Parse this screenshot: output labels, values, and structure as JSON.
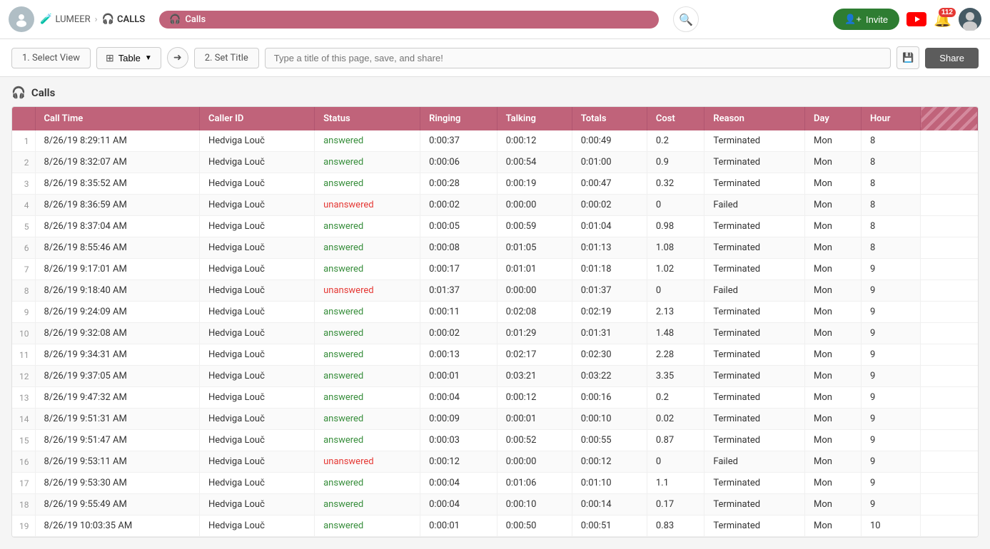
{
  "navbar": {
    "avatar_label": "avatar",
    "breadcrumb": [
      {
        "id": "lumeer",
        "icon": "🧪",
        "label": "LUMEER"
      },
      {
        "id": "calls",
        "icon": "🎧",
        "label": "CALLS"
      }
    ],
    "search_placeholder": "Calls",
    "invite_label": "Invite",
    "notif_count": "112",
    "calls_tab": "Calls"
  },
  "toolbar": {
    "step1_label": "1. Select View",
    "table_label": "Table",
    "step2_label": "2. Set Title",
    "title_placeholder": "Type a title of this page, save, and share!",
    "share_label": "Share"
  },
  "section": {
    "icon": "🎧",
    "title": "Calls"
  },
  "table": {
    "columns": [
      {
        "id": "call_time",
        "label": "Call Time"
      },
      {
        "id": "caller_id",
        "label": "Caller ID"
      },
      {
        "id": "status",
        "label": "Status"
      },
      {
        "id": "ringing",
        "label": "Ringing"
      },
      {
        "id": "talking",
        "label": "Talking"
      },
      {
        "id": "totals",
        "label": "Totals"
      },
      {
        "id": "cost",
        "label": "Cost"
      },
      {
        "id": "reason",
        "label": "Reason"
      },
      {
        "id": "day",
        "label": "Day"
      },
      {
        "id": "hour",
        "label": "Hour"
      },
      {
        "id": "extra",
        "label": ""
      }
    ],
    "rows": [
      {
        "num": 1,
        "call_time": "8/26/19 8:29:11 AM",
        "caller_id": "Hedviga Louč",
        "status": "answered",
        "ringing": "0:00:37",
        "talking": "0:00:12",
        "totals": "0:00:49",
        "cost": "0.2",
        "reason": "Terminated",
        "day": "Mon",
        "hour": "8"
      },
      {
        "num": 2,
        "call_time": "8/26/19 8:32:07 AM",
        "caller_id": "Hedviga Louč",
        "status": "answered",
        "ringing": "0:00:06",
        "talking": "0:00:54",
        "totals": "0:01:00",
        "cost": "0.9",
        "reason": "Terminated",
        "day": "Mon",
        "hour": "8"
      },
      {
        "num": 3,
        "call_time": "8/26/19 8:35:52 AM",
        "caller_id": "Hedviga Louč",
        "status": "answered",
        "ringing": "0:00:28",
        "talking": "0:00:19",
        "totals": "0:00:47",
        "cost": "0.32",
        "reason": "Terminated",
        "day": "Mon",
        "hour": "8"
      },
      {
        "num": 4,
        "call_time": "8/26/19 8:36:59 AM",
        "caller_id": "Hedviga Louč",
        "status": "unanswered",
        "ringing": "0:00:02",
        "talking": "0:00:00",
        "totals": "0:00:02",
        "cost": "0",
        "reason": "Failed",
        "day": "Mon",
        "hour": "8"
      },
      {
        "num": 5,
        "call_time": "8/26/19 8:37:04 AM",
        "caller_id": "Hedviga Louč",
        "status": "answered",
        "ringing": "0:00:05",
        "talking": "0:00:59",
        "totals": "0:01:04",
        "cost": "0.98",
        "reason": "Terminated",
        "day": "Mon",
        "hour": "8"
      },
      {
        "num": 6,
        "call_time": "8/26/19 8:55:46 AM",
        "caller_id": "Hedviga Louč",
        "status": "answered",
        "ringing": "0:00:08",
        "talking": "0:01:05",
        "totals": "0:01:13",
        "cost": "1.08",
        "reason": "Terminated",
        "day": "Mon",
        "hour": "8"
      },
      {
        "num": 7,
        "call_time": "8/26/19 9:17:01 AM",
        "caller_id": "Hedviga Louč",
        "status": "answered",
        "ringing": "0:00:17",
        "talking": "0:01:01",
        "totals": "0:01:18",
        "cost": "1.02",
        "reason": "Terminated",
        "day": "Mon",
        "hour": "9"
      },
      {
        "num": 8,
        "call_time": "8/26/19 9:18:40 AM",
        "caller_id": "Hedviga Louč",
        "status": "unanswered",
        "ringing": "0:01:37",
        "talking": "0:00:00",
        "totals": "0:01:37",
        "cost": "0",
        "reason": "Failed",
        "day": "Mon",
        "hour": "9"
      },
      {
        "num": 9,
        "call_time": "8/26/19 9:24:09 AM",
        "caller_id": "Hedviga Louč",
        "status": "answered",
        "ringing": "0:00:11",
        "talking": "0:02:08",
        "totals": "0:02:19",
        "cost": "2.13",
        "reason": "Terminated",
        "day": "Mon",
        "hour": "9"
      },
      {
        "num": 10,
        "call_time": "8/26/19 9:32:08 AM",
        "caller_id": "Hedviga Louč",
        "status": "answered",
        "ringing": "0:00:02",
        "talking": "0:01:29",
        "totals": "0:01:31",
        "cost": "1.48",
        "reason": "Terminated",
        "day": "Mon",
        "hour": "9"
      },
      {
        "num": 11,
        "call_time": "8/26/19 9:34:31 AM",
        "caller_id": "Hedviga Louč",
        "status": "answered",
        "ringing": "0:00:13",
        "talking": "0:02:17",
        "totals": "0:02:30",
        "cost": "2.28",
        "reason": "Terminated",
        "day": "Mon",
        "hour": "9"
      },
      {
        "num": 12,
        "call_time": "8/26/19 9:37:05 AM",
        "caller_id": "Hedviga Louč",
        "status": "answered",
        "ringing": "0:00:01",
        "talking": "0:03:21",
        "totals": "0:03:22",
        "cost": "3.35",
        "reason": "Terminated",
        "day": "Mon",
        "hour": "9"
      },
      {
        "num": 13,
        "call_time": "8/26/19 9:47:32 AM",
        "caller_id": "Hedviga Louč",
        "status": "answered",
        "ringing": "0:00:04",
        "talking": "0:00:12",
        "totals": "0:00:16",
        "cost": "0.2",
        "reason": "Terminated",
        "day": "Mon",
        "hour": "9"
      },
      {
        "num": 14,
        "call_time": "8/26/19 9:51:31 AM",
        "caller_id": "Hedviga Louč",
        "status": "answered",
        "ringing": "0:00:09",
        "talking": "0:00:01",
        "totals": "0:00:10",
        "cost": "0.02",
        "reason": "Terminated",
        "day": "Mon",
        "hour": "9"
      },
      {
        "num": 15,
        "call_time": "8/26/19 9:51:47 AM",
        "caller_id": "Hedviga Louč",
        "status": "answered",
        "ringing": "0:00:03",
        "talking": "0:00:52",
        "totals": "0:00:55",
        "cost": "0.87",
        "reason": "Terminated",
        "day": "Mon",
        "hour": "9"
      },
      {
        "num": 16,
        "call_time": "8/26/19 9:53:11 AM",
        "caller_id": "Hedviga Louč",
        "status": "unanswered",
        "ringing": "0:00:12",
        "talking": "0:00:00",
        "totals": "0:00:12",
        "cost": "0",
        "reason": "Failed",
        "day": "Mon",
        "hour": "9"
      },
      {
        "num": 17,
        "call_time": "8/26/19 9:53:30 AM",
        "caller_id": "Hedviga Louč",
        "status": "answered",
        "ringing": "0:00:04",
        "talking": "0:01:06",
        "totals": "0:01:10",
        "cost": "1.1",
        "reason": "Terminated",
        "day": "Mon",
        "hour": "9"
      },
      {
        "num": 18,
        "call_time": "8/26/19 9:55:49 AM",
        "caller_id": "Hedviga Louč",
        "status": "answered",
        "ringing": "0:00:04",
        "talking": "0:00:10",
        "totals": "0:00:14",
        "cost": "0.17",
        "reason": "Terminated",
        "day": "Mon",
        "hour": "9"
      },
      {
        "num": 19,
        "call_time": "8/26/19 10:03:35 AM",
        "caller_id": "Hedviga Louč",
        "status": "answered",
        "ringing": "0:00:01",
        "talking": "0:00:50",
        "totals": "0:00:51",
        "cost": "0.83",
        "reason": "Terminated",
        "day": "Mon",
        "hour": "10"
      }
    ]
  }
}
